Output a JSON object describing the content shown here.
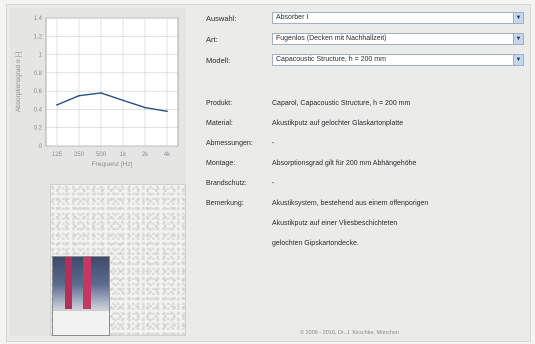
{
  "form": {
    "rows": [
      {
        "label": "Auswahl:",
        "value": "Absorber I"
      },
      {
        "label": "Art:",
        "value": "Fugenlos (Decken mit Nachhallzeit)"
      },
      {
        "label": "Modell:",
        "value": "Capacoustic Structure, h = 200 mm"
      }
    ]
  },
  "info": {
    "rows": [
      {
        "label": "Produkt:",
        "value": "Caparol, Capacoustic Structure, h = 200 mm"
      },
      {
        "label": "Material:",
        "value": "Akustikputz auf gelochter Glaskartonplatte"
      },
      {
        "label": "Abmessungen:",
        "value": "-"
      },
      {
        "label": "Montage:",
        "value": "Absorptionsgrad gilt für 200 mm Abhängehöhe"
      },
      {
        "label": "Brandschutz:",
        "value": "-"
      },
      {
        "label": "Bemerkung:",
        "value": "Akustiksystem, bestehend aus einem offenporigen"
      },
      {
        "label": "",
        "value": "Akustikputz auf einer Vliesbeschichteten"
      },
      {
        "label": "",
        "value": "gelochten Gipskartondecke."
      }
    ]
  },
  "footer": "© 2006 - 2010, Dr. J. Kirschke, München",
  "chart_data": {
    "type": "line",
    "categories": [
      "125",
      "250",
      "500",
      "1k",
      "2k",
      "4k"
    ],
    "series": [
      {
        "values": [
          0.45,
          0.55,
          0.58,
          0.5,
          0.42,
          0.38
        ]
      }
    ],
    "xlabel": "Frequenz [Hz]",
    "ylabel": "Absorptionsgrad α [-]",
    "ylim": [
      0,
      1.4
    ],
    "yticks": [
      "0",
      "0.2",
      "0.4",
      "0.6",
      "0.8",
      "1",
      "1.2",
      "1.4"
    ],
    "grid": true,
    "line_color": "#2d4f8c"
  }
}
